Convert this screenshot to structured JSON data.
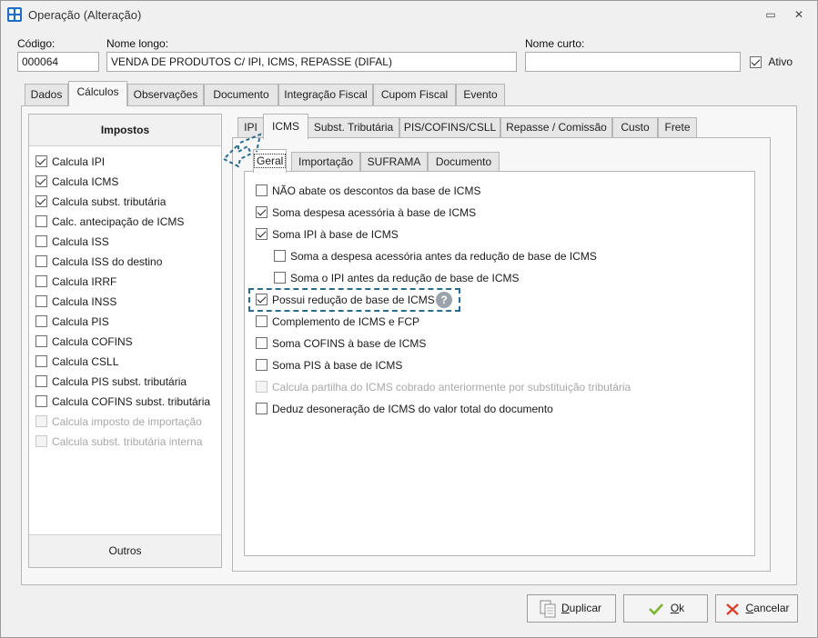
{
  "window": {
    "title": "Operação (Alteração)",
    "restore_glyph": "▭",
    "close_glyph": "✕"
  },
  "fields": {
    "codigo_label": "Código:",
    "codigo_value": "000064",
    "nome_longo_label": "Nome longo:",
    "nome_longo_value": "VENDA DE PRODUTOS C/ IPI, ICMS, REPASSE (DIFAL)",
    "nome_curto_label": "Nome curto:",
    "nome_curto_value": "",
    "ativo_label": "Ativo",
    "ativo_checked": true
  },
  "main_tabs": [
    {
      "label": "Dados",
      "active": false
    },
    {
      "label": "Cálculos",
      "active": true
    },
    {
      "label": "Observações",
      "active": false
    },
    {
      "label": "Documento",
      "active": false
    },
    {
      "label": "Integração Fiscal",
      "active": false
    },
    {
      "label": "Cupom Fiscal",
      "active": false
    },
    {
      "label": "Evento",
      "active": false
    }
  ],
  "impostos": {
    "header": "Impostos",
    "footer": "Outros",
    "items": [
      {
        "label": "Calcula IPI",
        "checked": true,
        "disabled": false
      },
      {
        "label": "Calcula ICMS",
        "checked": true,
        "disabled": false
      },
      {
        "label": "Calcula subst. tributária",
        "checked": true,
        "disabled": false
      },
      {
        "label": "Calc. antecipação de ICMS",
        "checked": false,
        "disabled": false
      },
      {
        "label": "Calcula ISS",
        "checked": false,
        "disabled": false
      },
      {
        "label": "Calcula ISS do destino",
        "checked": false,
        "disabled": false
      },
      {
        "label": "Calcula IRRF",
        "checked": false,
        "disabled": false
      },
      {
        "label": "Calcula INSS",
        "checked": false,
        "disabled": false
      },
      {
        "label": "Calcula PIS",
        "checked": false,
        "disabled": false
      },
      {
        "label": "Calcula COFINS",
        "checked": false,
        "disabled": false
      },
      {
        "label": "Calcula CSLL",
        "checked": false,
        "disabled": false
      },
      {
        "label": "Calcula PIS subst. tributária",
        "checked": false,
        "disabled": false
      },
      {
        "label": "Calcula COFINS subst. tributária",
        "checked": false,
        "disabled": false
      },
      {
        "label": "Calcula imposto de importação",
        "checked": false,
        "disabled": true
      },
      {
        "label": "Calcula subst. tributária interna",
        "checked": false,
        "disabled": true
      }
    ]
  },
  "calc_tabs": [
    {
      "label": "IPI",
      "active": false
    },
    {
      "label": "ICMS",
      "active": true
    },
    {
      "label": "Subst. Tributária",
      "active": false
    },
    {
      "label": "PIS/COFINS/CSLL",
      "active": false
    },
    {
      "label": "Repasse / Comissão",
      "active": false
    },
    {
      "label": "Custo",
      "active": false
    },
    {
      "label": "Frete",
      "active": false
    }
  ],
  "icms_tabs": [
    {
      "label": "Geral",
      "active": true
    },
    {
      "label": "Importação",
      "active": false
    },
    {
      "label": "SUFRAMA",
      "active": false
    },
    {
      "label": "Documento",
      "active": false
    }
  ],
  "icms_options": [
    {
      "label": "NÃO abate os descontos da base de ICMS",
      "checked": false,
      "disabled": false,
      "indent": false
    },
    {
      "label": "Soma despesa acessória à base de ICMS",
      "checked": true,
      "disabled": false,
      "indent": false
    },
    {
      "label": "Soma IPI à base de ICMS",
      "checked": true,
      "disabled": false,
      "indent": false
    },
    {
      "label": "Soma a despesa acessória antes da redução de base de ICMS",
      "checked": false,
      "disabled": false,
      "indent": true
    },
    {
      "label": "Soma o IPI antes da redução de base de ICMS",
      "checked": false,
      "disabled": false,
      "indent": true
    },
    {
      "label": "Possui redução de base de ICMS",
      "checked": true,
      "disabled": false,
      "indent": false
    },
    {
      "label": "Complemento de ICMS e FCP",
      "checked": false,
      "disabled": false,
      "indent": false
    },
    {
      "label": "Soma COFINS à base de ICMS",
      "checked": false,
      "disabled": false,
      "indent": false
    },
    {
      "label": "Soma PIS à base de ICMS",
      "checked": false,
      "disabled": false,
      "indent": false
    },
    {
      "label": "Calcula partilha do ICMS cobrado anteriormente por substituição tributária",
      "checked": false,
      "disabled": true,
      "indent": false
    },
    {
      "label": "Deduz desoneração de ICMS do valor total do documento",
      "checked": false,
      "disabled": false,
      "indent": false
    }
  ],
  "help_glyph": "?",
  "buttons": {
    "duplicar": {
      "underline": "D",
      "rest": "uplicar"
    },
    "ok": {
      "underline": "O",
      "rest": "k"
    },
    "cancelar": {
      "underline": "C",
      "rest": "ancelar"
    }
  },
  "colors": {
    "accent": "#1f6fc5",
    "focus_dash": "#2b6c8e",
    "ok_check": "#7cb82f",
    "cancel_x": "#d9412b"
  }
}
